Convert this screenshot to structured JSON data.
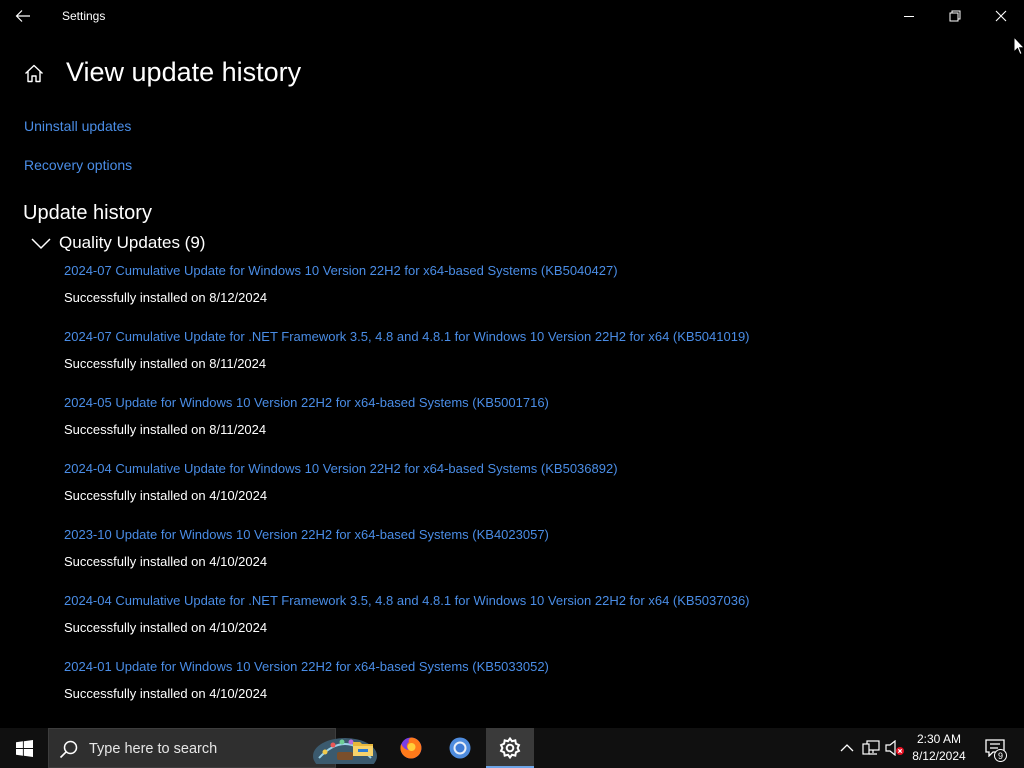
{
  "titlebar": {
    "title": "Settings"
  },
  "page": {
    "title": "View update history"
  },
  "links": {
    "uninstall": "Uninstall updates",
    "recovery": "Recovery options"
  },
  "section": {
    "title": "Update history"
  },
  "group": {
    "label": "Quality Updates (9)"
  },
  "updates": [
    {
      "title": "2024-07 Cumulative Update for Windows 10 Version 22H2 for x64-based Systems (KB5040427)",
      "status": "Successfully installed on 8/12/2024"
    },
    {
      "title": "2024-07 Cumulative Update for .NET Framework 3.5, 4.8 and 4.8.1 for Windows 10 Version 22H2 for x64 (KB5041019)",
      "status": "Successfully installed on 8/11/2024"
    },
    {
      "title": "2024-05 Update for Windows 10 Version 22H2 for x64-based Systems (KB5001716)",
      "status": "Successfully installed on 8/11/2024"
    },
    {
      "title": "2024-04 Cumulative Update for Windows 10 Version 22H2 for x64-based Systems (KB5036892)",
      "status": "Successfully installed on 4/10/2024"
    },
    {
      "title": "2023-10 Update for Windows 10 Version 22H2 for x64-based Systems (KB4023057)",
      "status": "Successfully installed on 4/10/2024"
    },
    {
      "title": "2024-04 Cumulative Update for .NET Framework 3.5, 4.8 and 4.8.1 for Windows 10 Version 22H2 for x64 (KB5037036)",
      "status": "Successfully installed on 4/10/2024"
    },
    {
      "title": "2024-01 Update for Windows 10 Version 22H2 for x64-based Systems (KB5033052)",
      "status": "Successfully installed on 4/10/2024"
    }
  ],
  "taskbar": {
    "search_placeholder": "Type here to search",
    "apps": [
      "file-explorer",
      "firefox",
      "chrome",
      "settings"
    ],
    "active_app": "settings",
    "time": "2:30 AM",
    "date": "8/12/2024",
    "notification_count": "9"
  },
  "colors": {
    "background": "#000000",
    "link": "#4a8de6",
    "taskbar": "#101010"
  }
}
